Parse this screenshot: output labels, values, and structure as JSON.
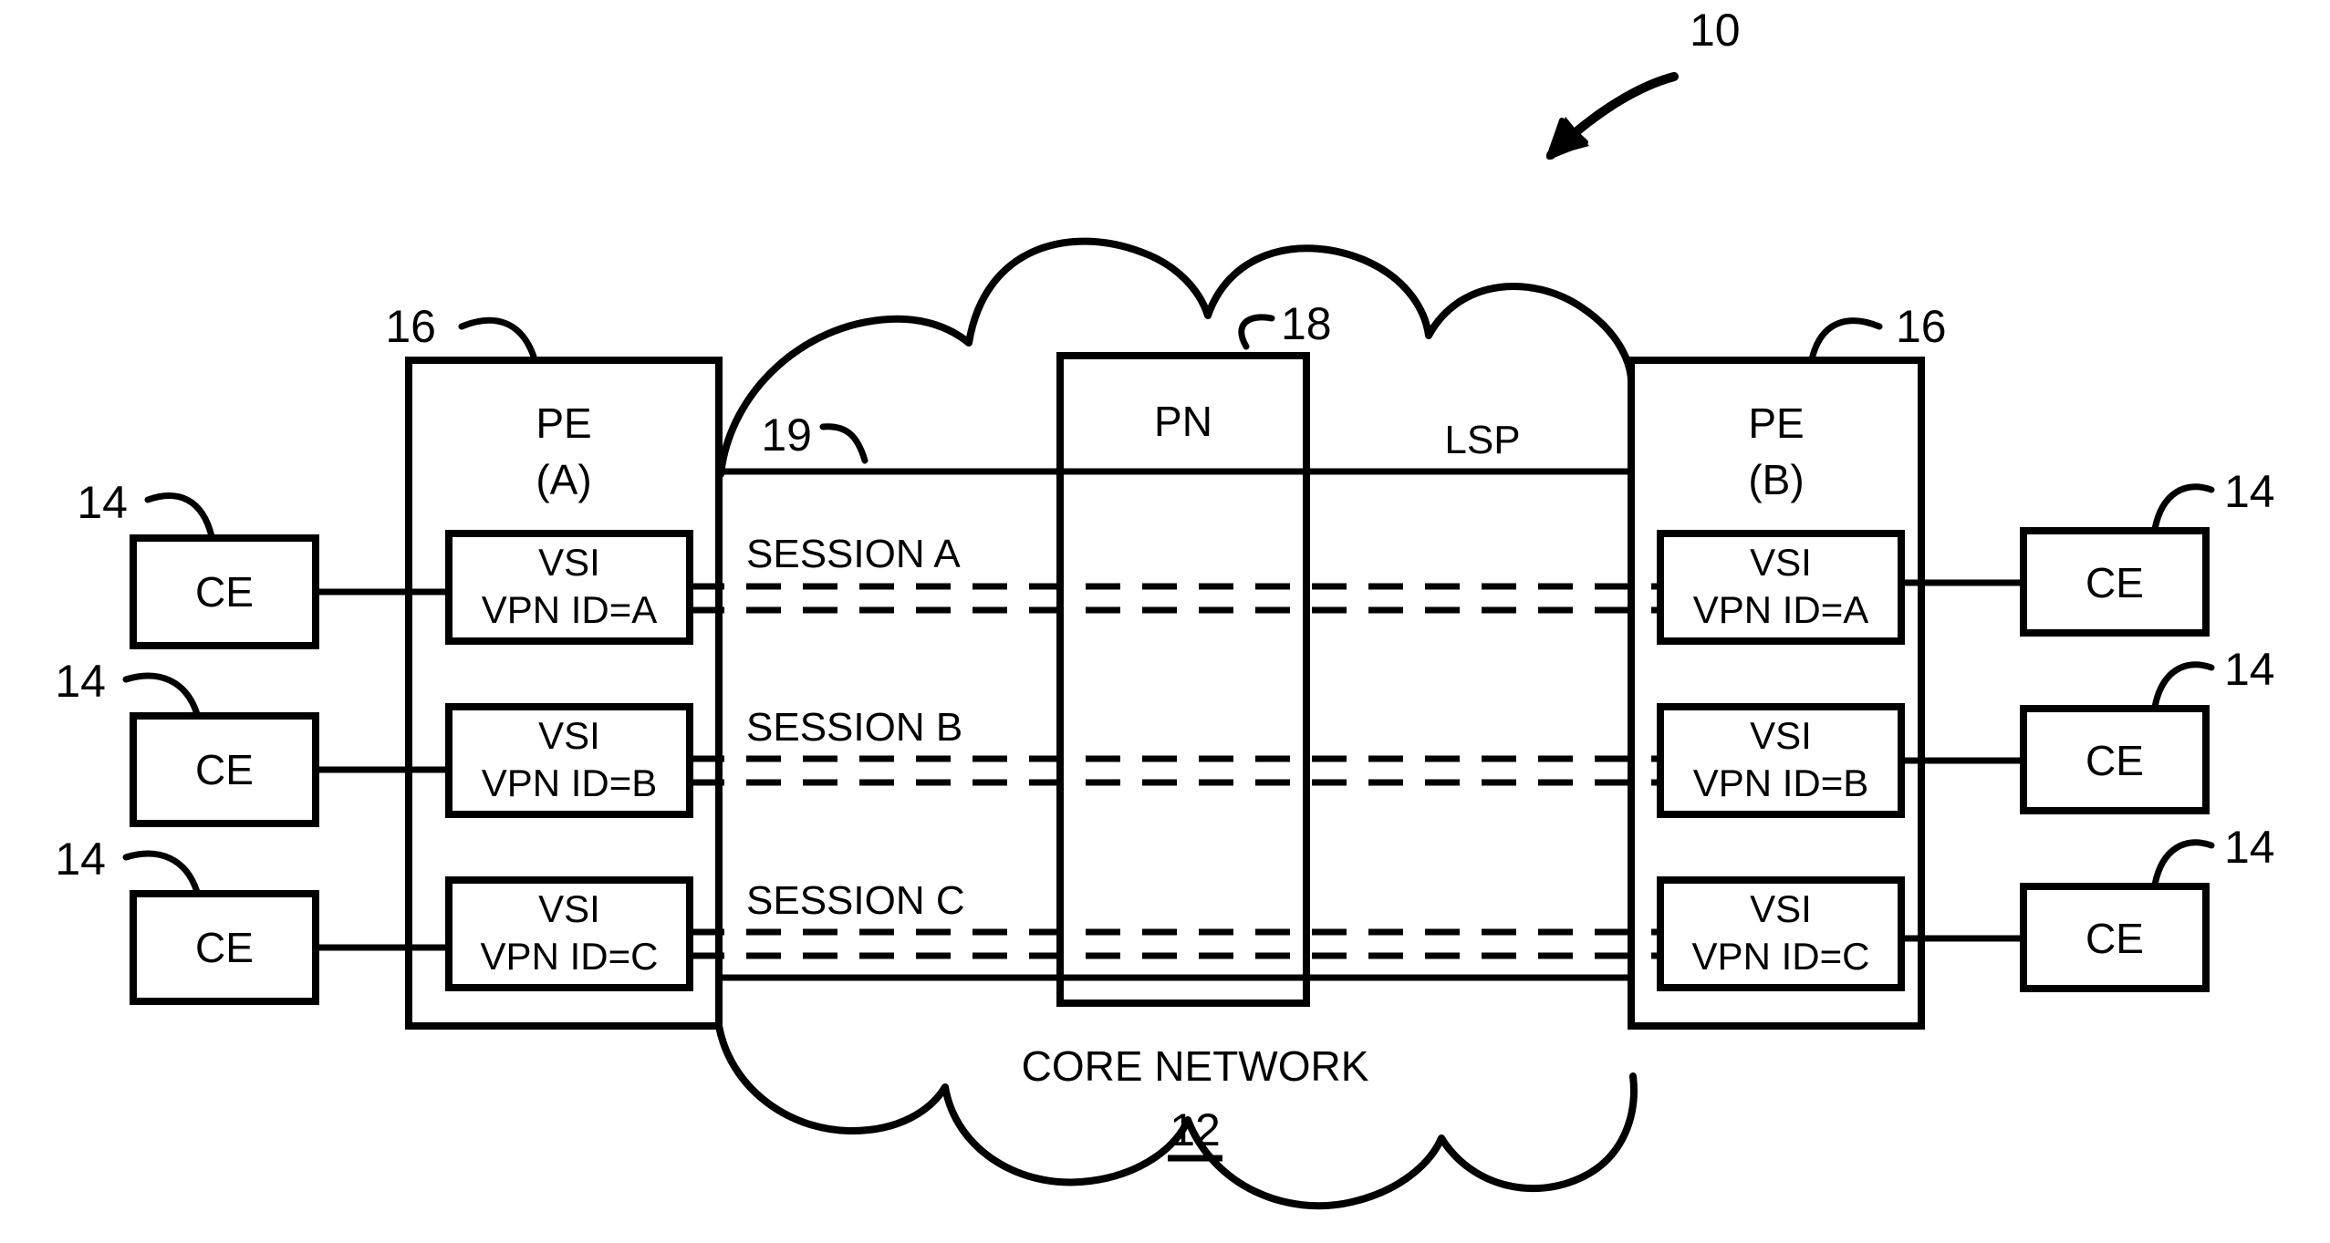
{
  "figure": {
    "reference_numeral": "10",
    "core_network": {
      "label": "CORE NETWORK",
      "numeral": "12"
    },
    "lsp_label": "LSP",
    "lsp_numeral": "19",
    "provider_node": {
      "label": "PN",
      "numeral": "18"
    },
    "pe_numeral_left": "16",
    "pe_numeral_right": "16",
    "pe_left": {
      "line1": "PE",
      "line2": "(A)"
    },
    "pe_right": {
      "line1": "PE",
      "line2": "(B)"
    },
    "vsi_left": [
      {
        "line1": "VSI",
        "line2": "VPN ID=A"
      },
      {
        "line1": "VSI",
        "line2": "VPN ID=B"
      },
      {
        "line1": "VSI",
        "line2": "VPN ID=C"
      }
    ],
    "vsi_right": [
      {
        "line1": "VSI",
        "line2": "VPN ID=A"
      },
      {
        "line1": "VSI",
        "line2": "VPN ID=B"
      },
      {
        "line1": "VSI",
        "line2": "VPN ID=C"
      }
    ],
    "ce_left": [
      {
        "label": "CE",
        "numeral": "14"
      },
      {
        "label": "CE",
        "numeral": "14"
      },
      {
        "label": "CE",
        "numeral": "14"
      }
    ],
    "ce_right": [
      {
        "label": "CE",
        "numeral": "14"
      },
      {
        "label": "CE",
        "numeral": "14"
      },
      {
        "label": "CE",
        "numeral": "14"
      }
    ],
    "sessions": [
      {
        "label": "SESSION A"
      },
      {
        "label": "SESSION B"
      },
      {
        "label": "SESSION C"
      }
    ],
    "colors": {
      "ink": "#000000",
      "paper": "#ffffff"
    }
  }
}
